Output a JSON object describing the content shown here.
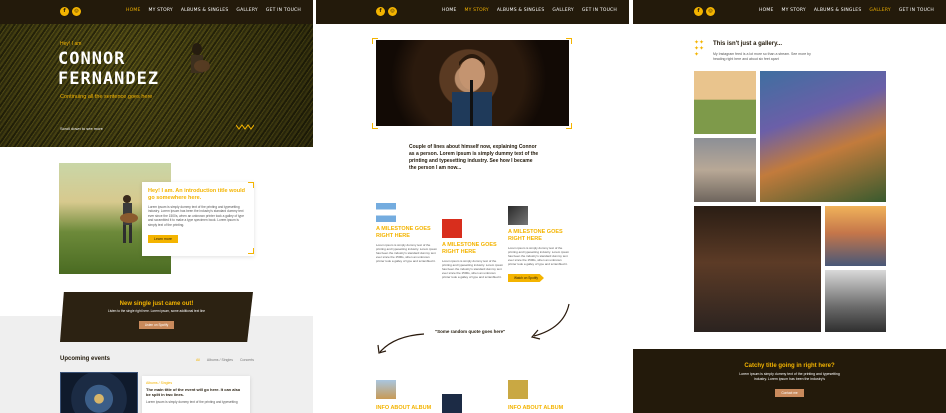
{
  "nav_items": [
    "HOME",
    "MY STORY",
    "ALBUMS & SINGLES",
    "GALLERY",
    "GET IN TOUCH"
  ],
  "brand": {
    "accent": "#f4b400",
    "dark": "#231a0b",
    "rose": "#c98a5c"
  },
  "social_icons": [
    "facebook-icon",
    "instagram-icon"
  ],
  "home": {
    "hero": {
      "greeting": "Hey! I am",
      "name_line1": "CONNOR",
      "name_line2": "FERNANDEZ",
      "tagline": "Continuing all the sentence goes here",
      "scroll_text": "Scroll down to see more"
    },
    "intro": {
      "title": "Hey! I am. An introduction title would go somewhere here.",
      "text": "Lorem ipsum is simply dummy text of the printing and typesetting industry. Lorem Ipsum has been the industry's standard dummy text ever since the 1500s, when an unknown printer took a galley of type and scrambled it to make a type specimen book. Lorem ipsum is simply text of the printing.",
      "button": "Learn more"
    },
    "banner": {
      "title": "New single just came out!",
      "text": "Listen to the single right here. Lorem ipsum, some additional text line",
      "button": "Listen on Spotify"
    },
    "upcoming": {
      "title": "Upcoming events",
      "tabs": [
        "All",
        "Albums / Singles",
        "Concerts"
      ],
      "event": {
        "category": "Albums / Singles",
        "title": "The main title of the event will go here. It can also be split in two lines.",
        "text": "Lorem ipsum is simply dummy text of the printing and typesetting"
      }
    }
  },
  "story": {
    "about": "Couple of lines about himself now, explaining Connor as a person. Lorem ipsum is simply dummy text of the printing and typesetting industry. See how I became the person I am now...",
    "milestones": [
      {
        "title": "A MILESTONE GOES RIGHT HERE",
        "text": "Lorem ipsum is simply dummy text of the printing and typesetting industry. Lorem ipsum has been the industry's standard dummy text ever since the 1500s, when an unknown printer took a galley of type and scrambled it."
      },
      {
        "title": "A MILESTONE GOES RIGHT HERE",
        "text": "Lorem ipsum is simply dummy text of the printing and typesetting industry. Lorem ipsum has been the industry's standard dummy text ever since the 1500s, when an unknown printer took a galley of type and scrambled it."
      },
      {
        "title": "A MILESTONE GOES RIGHT HERE",
        "text": "Lorem ipsum is simply dummy text of the printing and typesetting industry. Lorem ipsum has been the industry's standard dummy text ever since the 1500s, when an unknown printer took a galley of type and scrambled it.",
        "button": "Watch on Spotify"
      }
    ],
    "quote": "\"Some random quote goes here\"",
    "info_albums": [
      "INFO ABOUT ALBUM",
      "INFO ABOUT ALBUM"
    ]
  },
  "gallery": {
    "title": "This isn't just a gallery...",
    "text": "My Instagram feed is a lot more so than a stream. See more by heading right here and about six feet apart",
    "footer": {
      "title": "Catchy title going in right here?",
      "text": "Lorem ipsum is simply dummy text of the printing and typesetting industry. Lorem ipsum has been the industry's",
      "button": "Contact me"
    }
  }
}
